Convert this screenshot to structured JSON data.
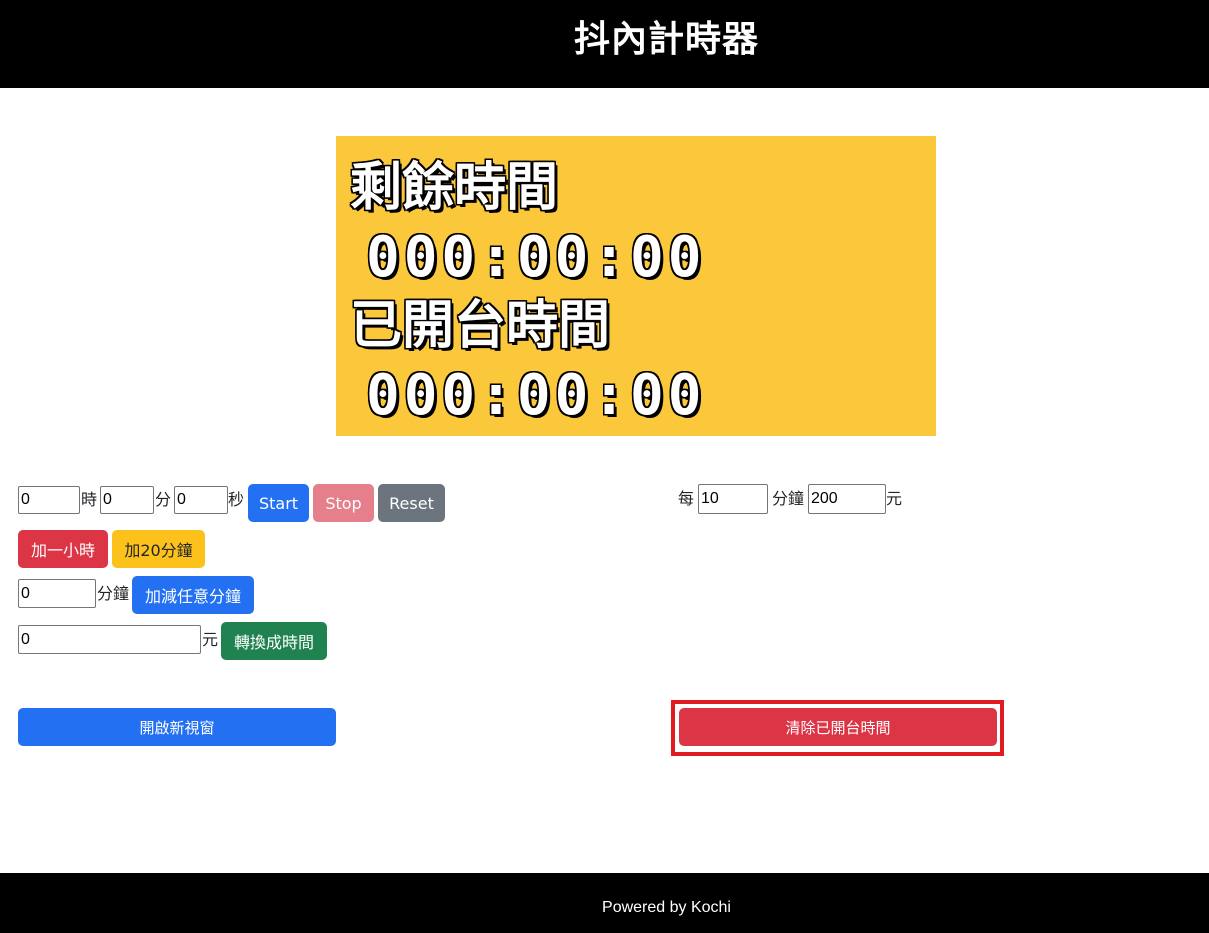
{
  "header": {
    "title": "抖內計時器"
  },
  "display": {
    "remaining_label": "剩餘時間",
    "remaining_time": "000:00:00",
    "elapsed_label": "已開台時間",
    "elapsed_time": "000:00:00",
    "background_color": "#fbc73b"
  },
  "timer_inputs": {
    "hours_value": "0",
    "hours_unit": "時",
    "minutes_value": "0",
    "minutes_unit": "分",
    "seconds_value": "0",
    "seconds_unit": "秒"
  },
  "controls": {
    "start_label": "Start",
    "stop_label": "Stop",
    "reset_label": "Reset",
    "add_hour_label": "加一小時",
    "add_20min_label": "加20分鐘"
  },
  "custom_minutes": {
    "value": "0",
    "unit": "分鐘",
    "button_label": "加減任意分鐘"
  },
  "convert": {
    "value": "0",
    "unit": "元",
    "button_label": "轉換成時間"
  },
  "rate": {
    "prefix": "每",
    "minutes_value": "10",
    "minutes_unit": "分鐘",
    "amount_value": "200",
    "amount_unit": "元"
  },
  "actions": {
    "open_window_label": "開啟新視窗",
    "clear_elapsed_label": "清除已開台時間"
  },
  "footer": {
    "text": "Powered by Kochi"
  },
  "colors": {
    "primary": "#2470f2",
    "danger": "#dc3545",
    "warning": "#fcc21b",
    "success": "#1f8250",
    "secondary": "#6c757d",
    "highlight": "#e21b23"
  }
}
